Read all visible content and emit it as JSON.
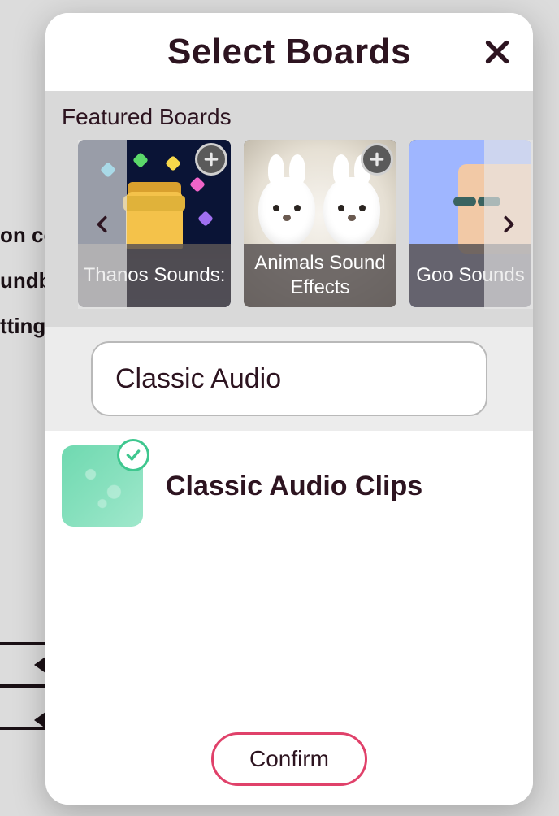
{
  "background": {
    "text1": "on co",
    "text2": "undbo",
    "text3": "tting o"
  },
  "modal": {
    "title": "Select Boards",
    "featured_heading": "Featured Boards",
    "search_value": "Classic Audio",
    "confirm_label": "Confirm"
  },
  "featured_items": [
    {
      "label": "Thanos Sounds:"
    },
    {
      "label": "Animals Sound Effects"
    },
    {
      "label": "Goo Sounds"
    }
  ],
  "results": [
    {
      "label": "Classic Audio Clips",
      "selected": true
    }
  ]
}
